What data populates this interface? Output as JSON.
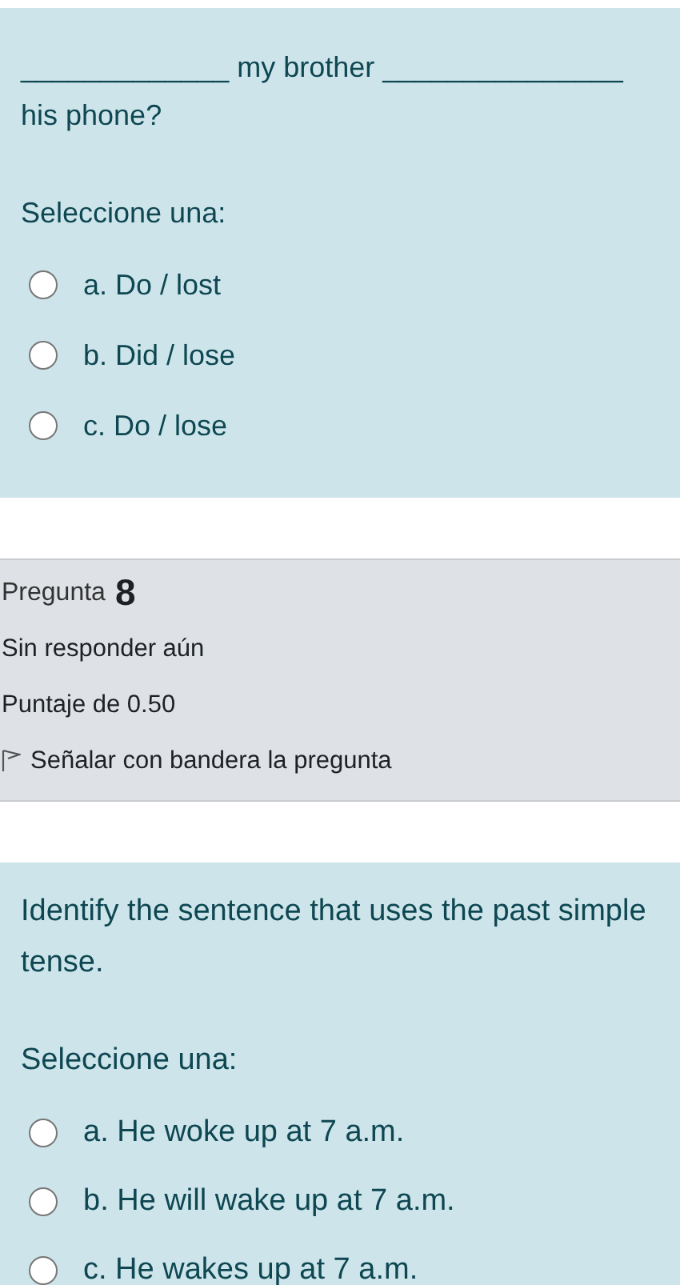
{
  "blocks": [
    {
      "kind": "question",
      "text": "_____________ my brother _______________ his phone?",
      "prompt": "Seleccione una:",
      "options": [
        {
          "label": "a. Do / lost",
          "selected": false
        },
        {
          "label": "b. Did / lose",
          "selected": false
        },
        {
          "label": "c. Do / lose",
          "selected": false
        }
      ]
    },
    {
      "kind": "info",
      "title": "Pregunta",
      "number": "8",
      "status": "Sin responder aún",
      "score": "Puntaje de 0.50",
      "flag": "Señalar con bandera la pregunta"
    },
    {
      "kind": "question",
      "text": "Identify the sentence that uses the past simple tense.",
      "prompt": "Seleccione una:",
      "options": [
        {
          "label": "a. He woke up at 7 a.m.",
          "selected": false
        },
        {
          "label": "b. He will wake up at 7 a.m.",
          "selected": false
        },
        {
          "label": "c. He wakes up at 7 a.m.",
          "selected": false
        }
      ]
    }
  ]
}
